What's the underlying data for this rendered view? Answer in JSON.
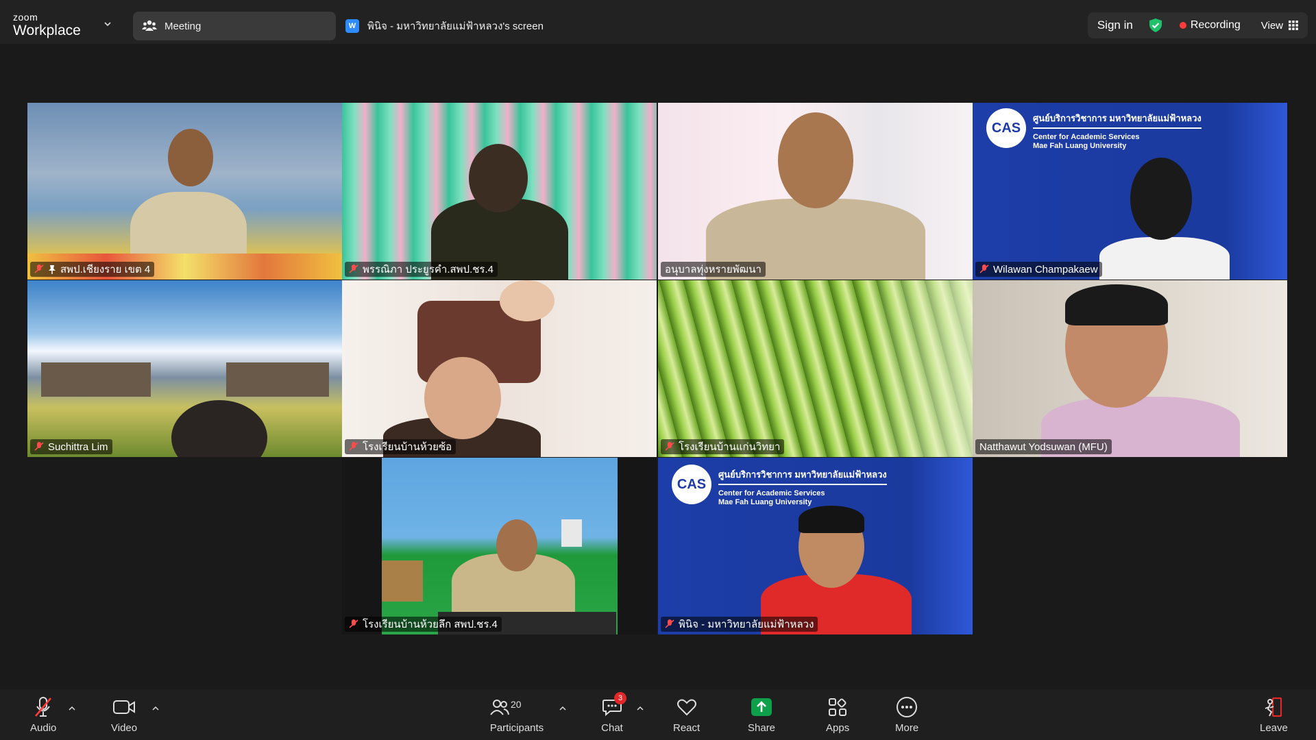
{
  "app": {
    "brand_small": "zoom",
    "brand_large": "Workplace"
  },
  "header": {
    "meeting_label": "Meeting",
    "share_badge": "W",
    "share_title": "พินิจ - มหาวิทยาลัยแม่ฟ้าหลวง's screen",
    "sign_in": "Sign in",
    "recording": "Recording",
    "view": "View"
  },
  "colors": {
    "active_border": "#22cc7a",
    "record_dot": "#ff3b3b",
    "share_green": "#0e9f4a",
    "cas_blue": "#1e3aa8"
  },
  "cas": {
    "logo": "CAS",
    "title_th": "ศูนย์บริการวิชาการ มหาวิทยาลัยแม่ฟ้าหลวง",
    "line1": "Center for Academic Services",
    "line2": "Mae Fah Luang University"
  },
  "participants": [
    {
      "name": "สพป.เชียงราย เขต 4",
      "muted": true,
      "pinned": true
    },
    {
      "name": "พรรณิภา ประยูรคำ.สพป.ชร.4",
      "muted": true
    },
    {
      "name": "อนุบาลทุ่งหรายพัฒนา",
      "muted": false
    },
    {
      "name": "Wilawan Champakaew",
      "muted": true
    },
    {
      "name": "Suchittra Lim",
      "muted": true
    },
    {
      "name": "โรงเรียนบ้านห้วยซ้อ",
      "muted": true
    },
    {
      "name": "โรงเรียนบ้านแก่นวิทยา",
      "muted": true
    },
    {
      "name": "Natthawut Yodsuwan (MFU)",
      "muted": false,
      "active_speaker": true
    },
    {
      "name": "โรงเรียนบ้านห้วยลึก สพป.ชร.4",
      "muted": true
    },
    {
      "name": "พินิจ - มหาวิทยาลัยแม่ฟ้าหลวง",
      "muted": true
    }
  ],
  "toolbar": {
    "audio": "Audio",
    "video": "Video",
    "participants": "Participants",
    "participants_count": "20",
    "chat": "Chat",
    "chat_badge": "3",
    "react": "React",
    "share": "Share",
    "apps": "Apps",
    "more": "More",
    "leave": "Leave"
  },
  "icons": [
    "chevron-down-icon",
    "participants-icon",
    "shield-check-icon",
    "grid-icon",
    "mic-muted-icon",
    "camera-icon",
    "chat-icon",
    "heart-icon",
    "share-arrow-icon",
    "apps-icon",
    "more-icon",
    "leave-icon",
    "pin-icon"
  ]
}
